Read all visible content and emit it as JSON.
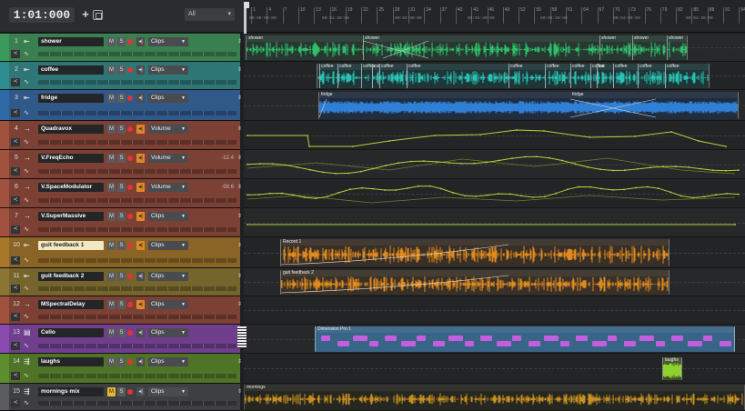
{
  "transport": {
    "time": "1:01:000",
    "filter": "All"
  },
  "ruler": {
    "bars": [
      "1",
      "4",
      "7",
      "10",
      "13",
      "16",
      "19",
      "22",
      "25",
      "28",
      "31",
      "34",
      "37",
      "40",
      "43",
      "46",
      "49",
      "52",
      "55",
      "58",
      "61",
      "64",
      "67",
      "70",
      "73",
      "76",
      "79",
      "82",
      "85",
      "88",
      "91",
      "94"
    ],
    "timecodes": [
      "00:00:00:00",
      "00:01:20:00",
      "00:02:00:00",
      "00:02:40:00",
      "00:03:20:00",
      "00:04:00:00",
      "00:04:40:00"
    ]
  },
  "tracks": [
    {
      "num": "1",
      "name": "shower",
      "type": "audio",
      "mode": "Clips",
      "value": "",
      "color": "#3a9a5c"
    },
    {
      "num": "2",
      "name": "coffee",
      "type": "audio",
      "mode": "Clips",
      "value": "",
      "color": "#2e8d8f"
    },
    {
      "num": "3",
      "name": "fridge",
      "type": "audio",
      "mode": "Clips",
      "value": "",
      "color": "#2f6aa8"
    },
    {
      "num": "4",
      "name": "Quadravox",
      "type": "bus",
      "mode": "Volume",
      "value": "",
      "color": "#a0523e"
    },
    {
      "num": "5",
      "name": "V.FreqEcho",
      "type": "bus",
      "mode": "Volume",
      "value": "-12.4",
      "color": "#a0523e"
    },
    {
      "num": "6",
      "name": "V.SpaceModulator",
      "type": "bus",
      "mode": "Volume",
      "value": "-98.6",
      "color": "#a0523e"
    },
    {
      "num": "7",
      "name": "V.SuperMassive",
      "type": "bus",
      "mode": "Clips",
      "value": "",
      "color": "#a0523e"
    },
    {
      "num": "10",
      "name": "guit feedback 1",
      "type": "audio",
      "mode": "Clips",
      "value": "",
      "color": "#a8782a",
      "highlight": true
    },
    {
      "num": "11",
      "name": "guit feedback 2",
      "type": "audio",
      "mode": "Clips",
      "value": "",
      "color": "#8a7531"
    },
    {
      "num": "12",
      "name": "MSpectralDelay",
      "type": "bus",
      "mode": "Clips",
      "value": "",
      "color": "#a0523e"
    },
    {
      "num": "13",
      "name": "Cello",
      "type": "instrument",
      "mode": "Clips",
      "value": "",
      "color": "#8a4bb0"
    },
    {
      "num": "14",
      "name": "laughs",
      "type": "sampler",
      "mode": "Clips",
      "value": "",
      "color": "#5c8d2e"
    },
    {
      "num": "15",
      "name": "mornings mix",
      "type": "sampler",
      "mode": "Clips",
      "value": "",
      "color": "#5a5c60",
      "mute": true
    }
  ],
  "clips": {
    "shower": [
      "shower",
      "shower",
      "shower",
      "shower",
      "shower"
    ],
    "coffee": [
      "coffee",
      "coffee",
      "coffee",
      "cut",
      "coffee",
      "coffee",
      "coffee",
      "coffee",
      "coffee",
      "coffee",
      "cut",
      "coffee",
      "coffee",
      "coffee"
    ],
    "fridge": [
      "fridge",
      "fridge"
    ],
    "guit1": "Record 1",
    "guit2": "guit feedback 2",
    "cello": "Dimension Pro 1",
    "laughs": "laughs",
    "mornings": "mornings"
  },
  "colors": {
    "shower_wave": "#2fbf6a",
    "coffee_wave": "#27c2b4",
    "fridge_wave": "#2f7fd6",
    "envelope": "#a8d63a",
    "guitar": "#e08a1e",
    "midi": "#c35ee0",
    "laughs": "#8fd12e",
    "mornings": "#c8911f"
  }
}
